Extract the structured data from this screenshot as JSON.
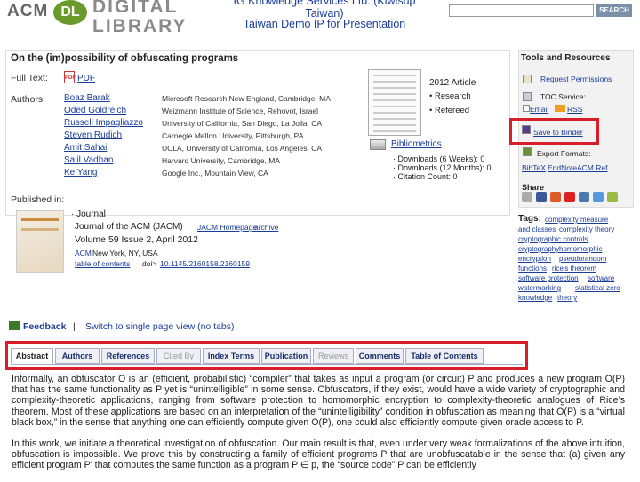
{
  "header": {
    "logo_acm": "ACM",
    "logo_dl": "DL",
    "logo_text_1": "DIGITAL",
    "logo_text_2": "LIBRARY",
    "org_line": "IG Knowledge Services Ltd. (Kiwisup Taiwan)",
    "demo_ip": "Taiwan Demo IP for Presentation",
    "search_placeholder": "",
    "search_button": "SEARCH"
  },
  "article": {
    "title": "On the (im)possibility of obfuscating programs",
    "full_text_label": "Full Text:",
    "pdf_icon_text": "PDF",
    "pdf_label": "PDF",
    "authors_label": "Authors:",
    "authors": [
      {
        "name": "Boaz Barak",
        "affiliation": "Microsoft Research New England, Cambridge, MA"
      },
      {
        "name": "Oded Goldreich",
        "affiliation": "Weizmann Institute of Science, Rehovot, Israel"
      },
      {
        "name": "Russell Impagliazzo",
        "affiliation": "University of California, San Diego, La Jolla, CA"
      },
      {
        "name": "Steven Rudich",
        "affiliation": "Carnegie Mellon University, Pittsburgh, PA"
      },
      {
        "name": "Amit Sahai",
        "affiliation": "UCLA, University of California, Los Angeles, CA"
      },
      {
        "name": "Salil Vadhan",
        "affiliation": "Harvard University, Cambridge, MA"
      },
      {
        "name": "Ke Yang",
        "affiliation": "Google Inc., Mountain View, CA"
      }
    ],
    "year_type": "2012 Article",
    "bullet_research": "• Research",
    "bullet_refereed": "• Refereed",
    "bibliometrics": "Bibliometrics",
    "downloads_6w": "· Downloads (6 Weeks): 0",
    "downloads_12m": "· Downloads (12 Months): 0",
    "citation_count": "· Citation Count: 0"
  },
  "published": {
    "label": "Published in:",
    "type": "· Journal",
    "journal_name": "Journal of the ACM (JACM)",
    "homepage": "JACM Homepage",
    "archive": "archive",
    "volume": "Volume 59 Issue 2, April 2012",
    "publisher": "ACM",
    "location": "New York, NY, USA",
    "toc": "table of contents",
    "doi_label": "doi>",
    "doi": "10.1145/2160158.2160159"
  },
  "sidebar": {
    "tools_title": "Tools and Resources",
    "request_permissions": "Request Permissions",
    "toc_service": "TOC Service:",
    "email": "Email",
    "rss": "RSS",
    "save_to_binder": "Save to Binder",
    "export_formats": "Export Formats:",
    "bibtex": "BibTeX",
    "endnote": "EndNote",
    "acm_ref": "ACM Ref",
    "share_label": "Share",
    "share_colors": [
      "#aaa",
      "#3b5998",
      "#e05a2a",
      "#dd2020",
      "#4a7ab0",
      "#5599dd",
      "#99bb44"
    ],
    "tags_label": "Tags:",
    "tags": [
      "complexity measure",
      "and classes",
      "complexity theory",
      "cryptographic controls",
      "cryptography",
      "homomorphic",
      "encryption",
      "pseudorandom",
      "functions",
      "rice's theorem",
      "software protection",
      "software",
      "watermarking",
      "statistical zero",
      "knowledge",
      "theory"
    ]
  },
  "feedback": {
    "label": "Feedback",
    "separator": "|",
    "switch_view": "Switch to single page view (no tabs)"
  },
  "tabs": [
    {
      "label": "Abstract",
      "state": "active"
    },
    {
      "label": "Authors",
      "state": "normal"
    },
    {
      "label": "References",
      "state": "normal"
    },
    {
      "label": "Cited By",
      "state": "disabled"
    },
    {
      "label": "Index Terms",
      "state": "normal"
    },
    {
      "label": "Publication",
      "state": "normal"
    },
    {
      "label": "Reviews",
      "state": "disabled"
    },
    {
      "label": "Comments",
      "state": "normal"
    },
    {
      "label": "Table of Contents",
      "state": "normal"
    }
  ],
  "abstract": {
    "p1": "Informally, an obfuscator O is an (efficient, probabilistic) “compiler” that takes as input a program (or circuit) P and produces a new program O(P) that has the same functionality as P yet is “unintelligible” in some sense. Obfuscators, if they exist, would have a wide variety of cryptographic and complexity-theoretic applications, ranging from software protection to homomorphic encryption to complexity-theoretic analogues of Rice’s theorem. Most of these applications are based on an interpretation of the “unintelligibility” condition in obfuscation as meaning that O(P) is a “virtual black box,” in the sense that anything one can efficiently compute given O(P), one could also efficiently compute given oracle access to P.",
    "p2": "In this work, we initiate a theoretical investigation of obfuscation. Our main result is that, even under very weak formalizations of the above intuition, obfuscation is impossible. We prove this by constructing a family of efficient programs P that are unobfuscatable in the sense that (a) given any efficient program P' that computes the same function as a program P ∈ p, the “source code” P can be efficiently"
  },
  "colors": {
    "accent_red": "#d81e2a",
    "link_blue": "#1a3d9a",
    "logo_green": "#6a9a2a"
  }
}
